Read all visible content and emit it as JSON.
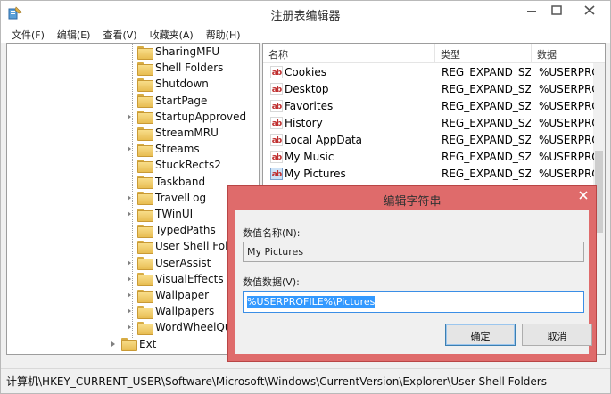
{
  "window": {
    "title": "注册表编辑器"
  },
  "menu": [
    "文件(F)",
    "编辑(E)",
    "查看(V)",
    "收藏夹(A)",
    "帮助(H)"
  ],
  "tree": {
    "items": [
      {
        "label": "SharingMFU",
        "expandable": false
      },
      {
        "label": "Shell Folders",
        "expandable": false
      },
      {
        "label": "Shutdown",
        "expandable": false
      },
      {
        "label": "StartPage",
        "expandable": false
      },
      {
        "label": "StartupApproved",
        "expandable": true
      },
      {
        "label": "StreamMRU",
        "expandable": false
      },
      {
        "label": "Streams",
        "expandable": true
      },
      {
        "label": "StuckRects2",
        "expandable": false
      },
      {
        "label": "Taskband",
        "expandable": false
      },
      {
        "label": "TravelLog",
        "expandable": true
      },
      {
        "label": "TWinUI",
        "expandable": true
      },
      {
        "label": "TypedPaths",
        "expandable": false
      },
      {
        "label": "User Shell Folde",
        "expandable": false
      },
      {
        "label": "UserAssist",
        "expandable": true
      },
      {
        "label": "VisualEffects",
        "expandable": true
      },
      {
        "label": "Wallpaper",
        "expandable": true
      },
      {
        "label": "Wallpapers",
        "expandable": true
      },
      {
        "label": "WordWheelQue",
        "expandable": true
      },
      {
        "label": "Ext",
        "expandable": true
      }
    ]
  },
  "list": {
    "columns": [
      "名称",
      "类型",
      "数据"
    ],
    "rows": [
      {
        "name": "Cookies",
        "type": "REG_EXPAND_SZ",
        "data": "%USERPRO"
      },
      {
        "name": "Desktop",
        "type": "REG_EXPAND_SZ",
        "data": "%USERPRO"
      },
      {
        "name": "Favorites",
        "type": "REG_EXPAND_SZ",
        "data": "%USERPRO"
      },
      {
        "name": "History",
        "type": "REG_EXPAND_SZ",
        "data": "%USERPRO"
      },
      {
        "name": "Local AppData",
        "type": "REG_EXPAND_SZ",
        "data": "%USERPRO"
      },
      {
        "name": "My Music",
        "type": "REG_EXPAND_SZ",
        "data": "%USERPRO"
      },
      {
        "name": "My Pictures",
        "type": "REG_EXPAND_SZ",
        "data": "%USERPRO"
      }
    ],
    "icon_text": "ab"
  },
  "status": {
    "path": "计算机\\HKEY_CURRENT_USER\\Software\\Microsoft\\Windows\\CurrentVersion\\Explorer\\User Shell Folders"
  },
  "dialog": {
    "title": "编辑字符串",
    "name_label": "数值名称(N):",
    "name_value": "My Pictures",
    "data_label": "数值数据(V):",
    "data_value": "%USERPROFILE%\\Pictures",
    "ok_label": "确定",
    "cancel_label": "取消"
  },
  "colors": {
    "dialog_frame": "#df6b6b",
    "selection": "#3399ff"
  }
}
